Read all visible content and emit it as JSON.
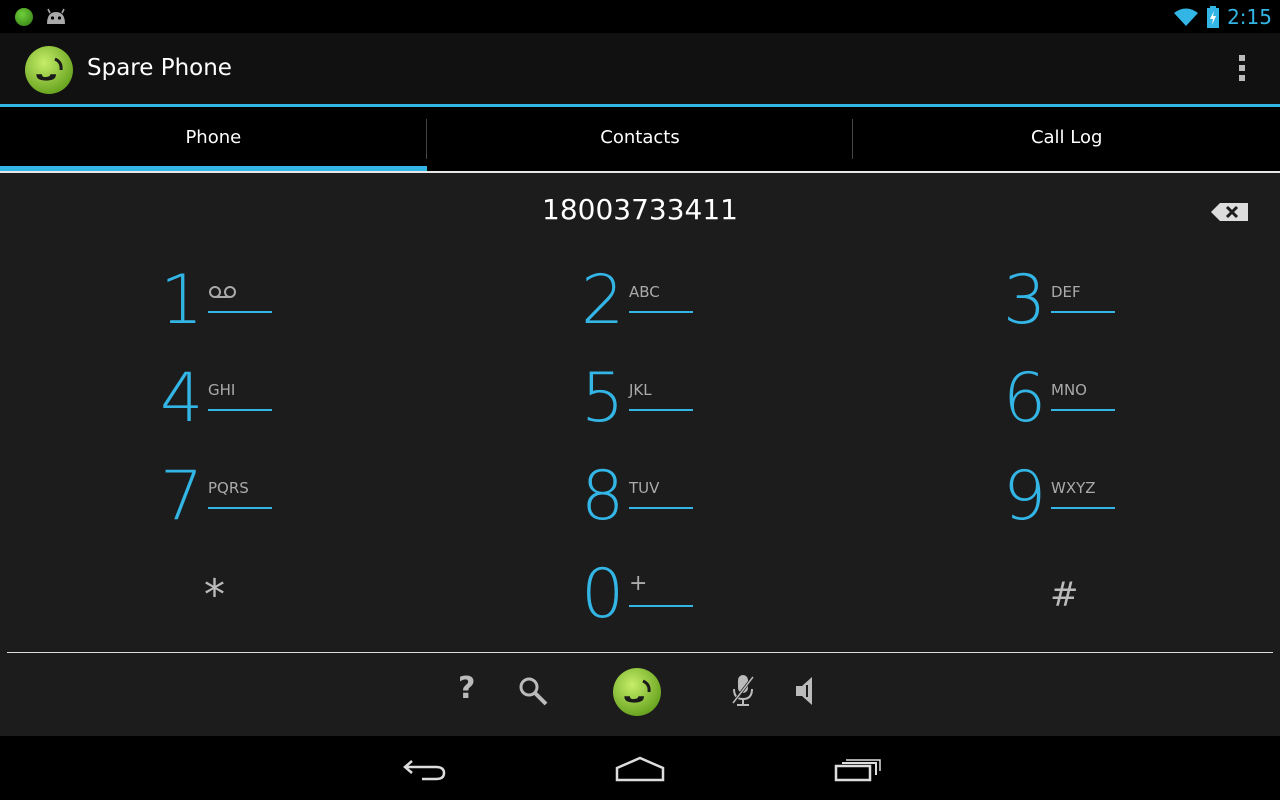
{
  "status_bar": {
    "time": "2:15"
  },
  "app": {
    "title": "Spare Phone"
  },
  "tabs": [
    {
      "label": "Phone",
      "selected": true
    },
    {
      "label": "Contacts",
      "selected": false
    },
    {
      "label": "Call Log",
      "selected": false
    }
  ],
  "dialer": {
    "number": "18003733411",
    "keys": [
      {
        "digit": "1",
        "letters": ""
      },
      {
        "digit": "2",
        "letters": "ABC"
      },
      {
        "digit": "3",
        "letters": "DEF"
      },
      {
        "digit": "4",
        "letters": "GHI"
      },
      {
        "digit": "5",
        "letters": "JKL"
      },
      {
        "digit": "6",
        "letters": "MNO"
      },
      {
        "digit": "7",
        "letters": "PQRS"
      },
      {
        "digit": "8",
        "letters": "TUV"
      },
      {
        "digit": "9",
        "letters": "WXYZ"
      },
      {
        "digit": "*",
        "letters": ""
      },
      {
        "digit": "0",
        "letters": "+"
      },
      {
        "digit": "#",
        "letters": ""
      }
    ]
  },
  "bottom_actions": {
    "help": "?"
  },
  "colors": {
    "accent": "#33b5e5",
    "call_green": "#8cc63f"
  }
}
